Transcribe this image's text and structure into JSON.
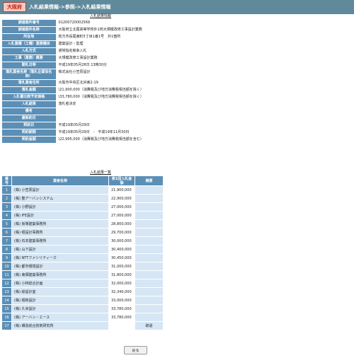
{
  "header": {
    "logo": "大阪府",
    "title": "入札結果情報->参照->入札結果情報"
  },
  "detail": {
    "caption": "入札結果情報",
    "rows": [
      {
        "label": "調達案件番号",
        "value": "01200720002569"
      },
      {
        "label": "調達案件名称",
        "value": "大阪府立北尾高等学校外1校大規模改修工事設計業務"
      },
      {
        "label": "所在地",
        "value": "枚方市長尾東町5丁目1番1号　外1箇所"
      },
      {
        "label": "入札業種（工種）業務種目",
        "value": "建築設計・監理"
      },
      {
        "label": "入札方式",
        "value": "通常指名競争入札"
      },
      {
        "label": "工事（業務）概要",
        "value": "大規模改修工事設計業務"
      },
      {
        "label": "開札日時",
        "value": "平成19年05月28日 13時30分"
      },
      {
        "label": "落札業者名称（落札企業体名称）",
        "value": "株式会社小笠原設計"
      },
      {
        "label": "落札業者住所",
        "value": "大阪市中央区北浜東2-19"
      },
      {
        "label": "落札金額",
        "value": "\\21,900,000（消費税及び地方消費税相当額を除く）"
      },
      {
        "label": "入札書比較予定価格",
        "value": "\\33,780,000（消費税及び地方消費税相当額を除く）"
      },
      {
        "label": "入札結果",
        "value": "落札者決定"
      },
      {
        "label": "備考",
        "value": ""
      },
      {
        "label": "最新約日",
        "value": ""
      },
      {
        "label": "契約日",
        "value": "平成19年05月29日"
      },
      {
        "label": "契約期間",
        "value": "平成19年05月29日　-　平成19年11月30日"
      },
      {
        "label": "契約金額",
        "value": "\\22,995,000（消費税及び地方消費税相当額を含む）"
      }
    ]
  },
  "results": {
    "caption": "入札結果一覧",
    "headers": {
      "no": "番号",
      "name": "業者名称",
      "amount": "第1回入札金額",
      "note": "摘要"
    },
    "rows": [
      {
        "no": "1",
        "name": "(株) 小笠原設計",
        "amount": "21,900,000",
        "note": ""
      },
      {
        "no": "2",
        "name": "(株) 聖アーバンシステム",
        "amount": "22,900,000",
        "note": ""
      },
      {
        "no": "3",
        "name": "(株) 小野設計",
        "amount": "27,000,000",
        "note": ""
      },
      {
        "no": "4",
        "name": "(株) IFE設計",
        "amount": "27,000,000",
        "note": ""
      },
      {
        "no": "5",
        "name": "(株) 坂場建築事務所",
        "amount": "28,800,000",
        "note": ""
      },
      {
        "no": "6",
        "name": "(株) 昭設計事務所",
        "amount": "29,700,000",
        "note": ""
      },
      {
        "no": "7",
        "name": "(株) 石本建築事務所",
        "amount": "30,000,000",
        "note": ""
      },
      {
        "no": "8",
        "name": "(株) 山下設計",
        "amount": "30,400,000",
        "note": ""
      },
      {
        "no": "9",
        "name": "(株) NTTファシリティーズ",
        "amount": "30,450,000",
        "note": ""
      },
      {
        "no": "10",
        "name": "(株) 都市環境設計",
        "amount": "31,000,000",
        "note": ""
      },
      {
        "no": "11",
        "name": "(株) 東畑建築事務所",
        "amount": "31,800,000",
        "note": ""
      },
      {
        "no": "12",
        "name": "(株) 小林総合計画",
        "amount": "32,000,000",
        "note": ""
      },
      {
        "no": "13",
        "name": "(株) 綜設計室",
        "amount": "32,340,000",
        "note": ""
      },
      {
        "no": "14",
        "name": "(株) 昭和設計",
        "amount": "33,000,000",
        "note": ""
      },
      {
        "no": "15",
        "name": "(株) 久米設計",
        "amount": "33,780,000",
        "note": ""
      },
      {
        "no": "16",
        "name": "(株) アーバン・エース",
        "amount": "33,780,000",
        "note": ""
      },
      {
        "no": "17",
        "name": "(株) 構造総合技術研究所",
        "amount": "",
        "note": "辞退"
      }
    ]
  },
  "back_label": "戻る"
}
